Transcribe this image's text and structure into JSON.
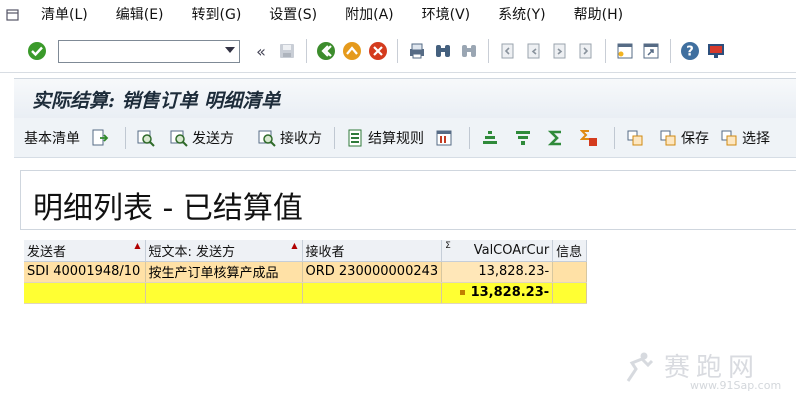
{
  "menubar": {
    "items": [
      "清单(L)",
      "编辑(E)",
      "转到(G)",
      "设置(S)",
      "附加(A)",
      "环境(V)",
      "系统(Y)",
      "帮助(H)"
    ]
  },
  "toolbar": {
    "command_value": "",
    "command_placeholder": ""
  },
  "title": "实际结算: 销售订单 明细清单",
  "app_toolbar": {
    "basic_list": "基本清单",
    "sender": "发送方",
    "receiver": "接收方",
    "settlement_rule": "结算规则",
    "save": "保存",
    "select": "选择"
  },
  "report": {
    "heading": "明细列表 - 已结算值"
  },
  "grid": {
    "columns": [
      "发送者",
      "短文本: 发送方",
      "接收者",
      "ValCOArCur",
      "信息"
    ],
    "sum_marker": "Σ",
    "rows": [
      {
        "sender": "SDI 40001948/10",
        "short_text": "按生产订单核算产成品",
        "receiver": "ORD 230000000243",
        "value": "13,828.23-",
        "info": ""
      }
    ],
    "total": {
      "value": "13,828.23-"
    }
  },
  "watermark": {
    "name": "赛跑网",
    "url": "www.91Sap.com"
  }
}
